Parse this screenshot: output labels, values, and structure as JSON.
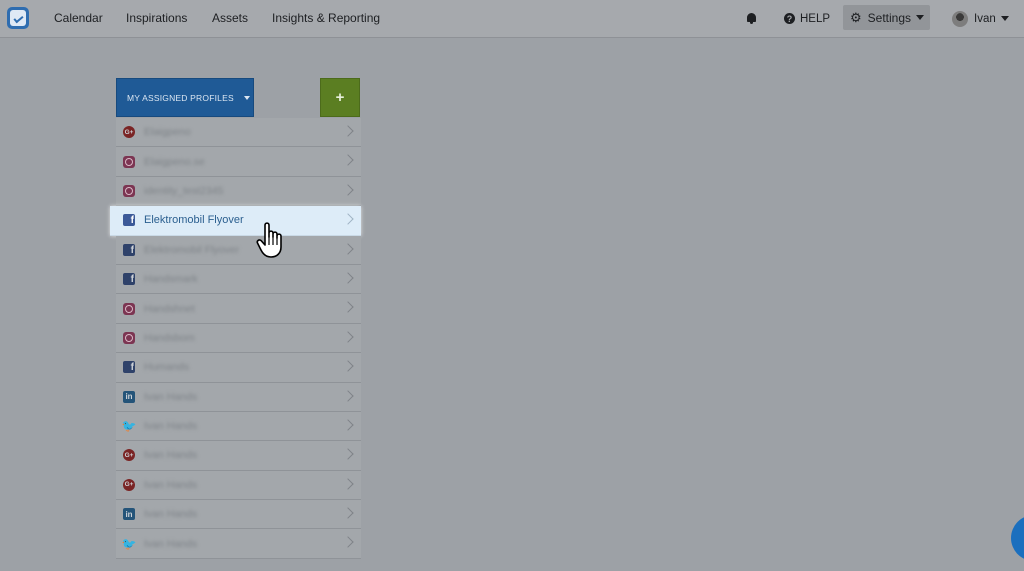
{
  "app": {
    "nav": [
      "Calendar",
      "Inspirations",
      "Assets",
      "Insights & Reporting"
    ],
    "help_label": "HELP",
    "settings_label": "Settings",
    "user_name": "Ivan"
  },
  "panel": {
    "profiles_button_label": "MY ASSIGNED PROFILES",
    "add_button_label": "+",
    "profiles": [
      {
        "network": "google-plus",
        "icon": "G+",
        "name": "Elaigpeno",
        "active": false
      },
      {
        "network": "instagram",
        "icon": "",
        "name": "Elaigpeno.se",
        "active": false
      },
      {
        "network": "instagram",
        "icon": "",
        "name": "identity_test2345",
        "active": false
      },
      {
        "network": "facebook",
        "icon": "f",
        "name": "Elektromobil Flyover",
        "active": true
      },
      {
        "network": "facebook",
        "icon": "f",
        "name": "Elektromobil Flyover",
        "active": false
      },
      {
        "network": "facebook",
        "icon": "f",
        "name": "Handsmark",
        "active": false
      },
      {
        "network": "instagram",
        "icon": "",
        "name": "Handshnet",
        "active": false
      },
      {
        "network": "instagram",
        "icon": "",
        "name": "Handsbom",
        "active": false
      },
      {
        "network": "facebook",
        "icon": "f",
        "name": "Humands",
        "active": false
      },
      {
        "network": "linkedin",
        "icon": "in",
        "name": "Ivan Hands",
        "active": false
      },
      {
        "network": "twitter",
        "icon": "🐦",
        "name": "Ivan Hands",
        "active": false
      },
      {
        "network": "google-plus",
        "icon": "G+",
        "name": "Ivan Hands",
        "active": false
      },
      {
        "network": "google-plus",
        "icon": "G+",
        "name": "Ivan Hands",
        "active": false
      },
      {
        "network": "linkedin",
        "icon": "in",
        "name": "Ivan Hands",
        "active": false
      },
      {
        "network": "twitter",
        "icon": "🐦",
        "name": "Ivan Hands",
        "active": false
      }
    ]
  },
  "colors": {
    "primary": "#1f5a96",
    "add_green": "#5b7e22",
    "highlight": "#ddecf8",
    "overlay": "#9da1a6"
  }
}
